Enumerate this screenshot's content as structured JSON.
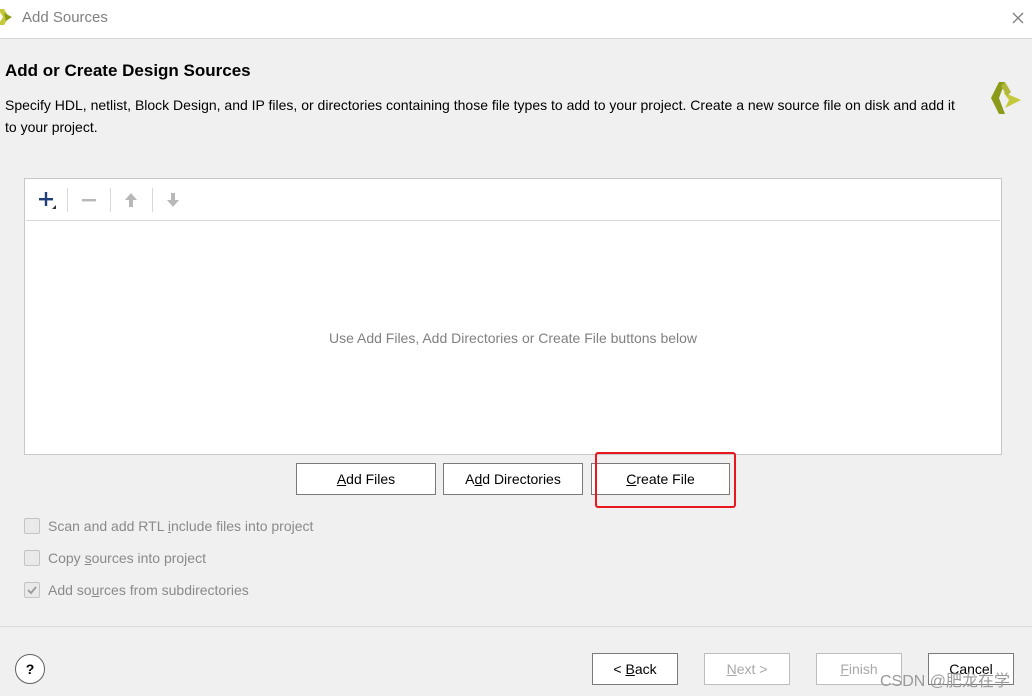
{
  "window": {
    "title": "Add Sources",
    "close_icon": "close-icon"
  },
  "header": {
    "title": "Add or Create Design Sources",
    "description": "Specify HDL, netlist, Block Design, and IP files, or directories containing those file types to add to your project. Create a new source file on disk and add it to your project.",
    "logo_icon": "vivado-logo-icon"
  },
  "file_table": {
    "toolbar_icons": [
      "add-icon",
      "remove-icon",
      "move-up-icon",
      "move-down-icon"
    ],
    "empty_message": "Use Add Files, Add Directories or Create File buttons below"
  },
  "actions": {
    "add_files": {
      "pre": "",
      "mnemonic": "A",
      "post": "dd Files"
    },
    "add_directories": {
      "pre": "A",
      "mnemonic": "d",
      "post": "d Directories"
    },
    "create_file": {
      "pre": "",
      "mnemonic": "C",
      "post": "reate File"
    }
  },
  "options": [
    {
      "pre": "Scan and add RTL ",
      "mnemonic": "i",
      "post": "nclude files into project",
      "checked": false,
      "enabled": false
    },
    {
      "pre": "Copy ",
      "mnemonic": "s",
      "post": "ources into project",
      "checked": false,
      "enabled": false
    },
    {
      "pre": "Add so",
      "mnemonic": "u",
      "post": "rces from subdirectories",
      "checked": true,
      "enabled": false
    }
  ],
  "footer": {
    "help_label": "?",
    "back": {
      "pre": "< ",
      "mnemonic": "B",
      "post": "ack"
    },
    "next": {
      "pre": "",
      "mnemonic": "N",
      "post": "ext >"
    },
    "finish": {
      "pre": "",
      "mnemonic": "F",
      "post": "inish"
    },
    "cancel": {
      "pre": "",
      "mnemonic": "",
      "post": "Cancel"
    }
  },
  "watermark": "CSDN @肥龙在学",
  "colors": {
    "accent_logo": "#8c9a1a",
    "highlight_box": "#e8181e"
  }
}
